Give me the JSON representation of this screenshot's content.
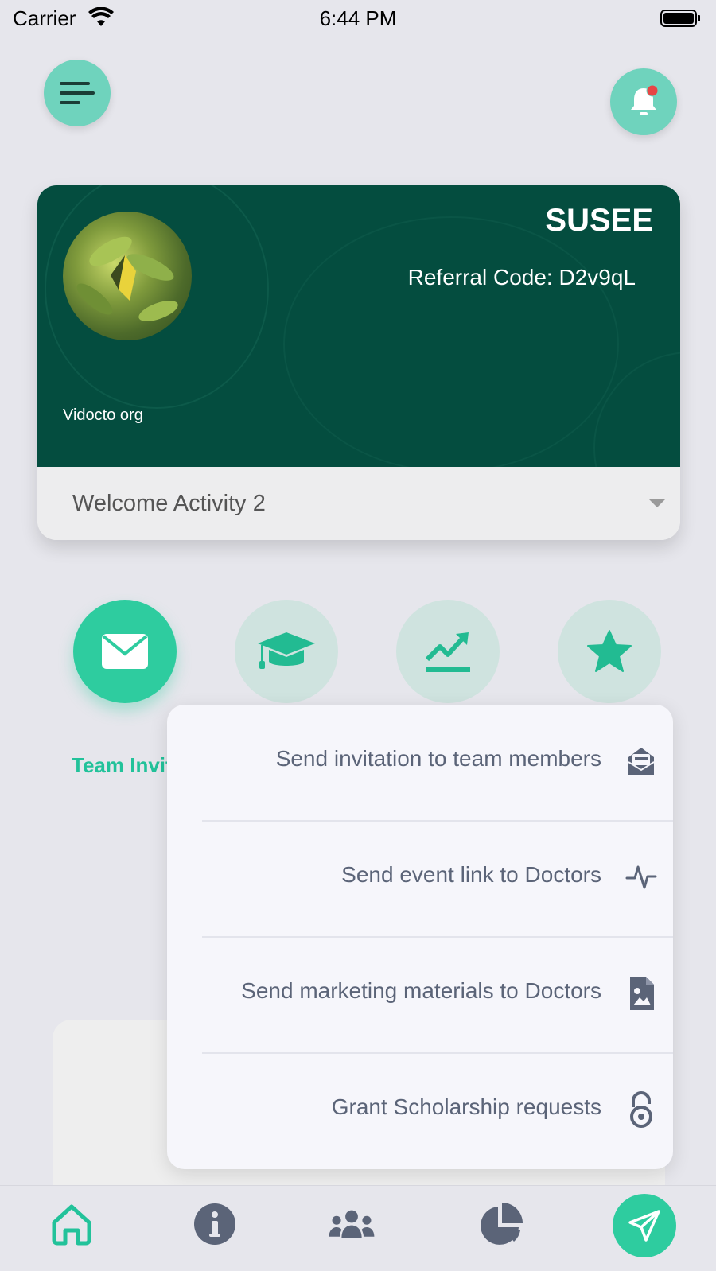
{
  "status_bar": {
    "carrier": "Carrier",
    "time": "6:44 PM"
  },
  "profile": {
    "username": "SUSEE",
    "referral_code": "Referral Code: D2v9qL",
    "org": "Vidocto org",
    "activity_selected": "Welcome Activity 2"
  },
  "actions": {
    "team_invitation_label": "Team Invitation",
    "active": "team-invitation"
  },
  "popup_menu": [
    {
      "label": "Send invitation to team members",
      "icon": "envelope-open-icon"
    },
    {
      "label": "Send event link to Doctors",
      "icon": "pulse-icon"
    },
    {
      "label": "Send marketing materials to Doctors",
      "icon": "file-image-icon"
    },
    {
      "label": "Grant Scholarship requests",
      "icon": "open-lock-icon"
    }
  ],
  "bottom_nav": [
    "home-icon",
    "info-icon",
    "team-icon",
    "pie-chart-icon",
    "send-icon"
  ],
  "colors": {
    "accent": "#2ecc9f",
    "accent_light": "#6fd3bd",
    "card_dark": "#044d3f",
    "muted_circle": "#cfe3df",
    "icon_gray": "#5b6478"
  }
}
